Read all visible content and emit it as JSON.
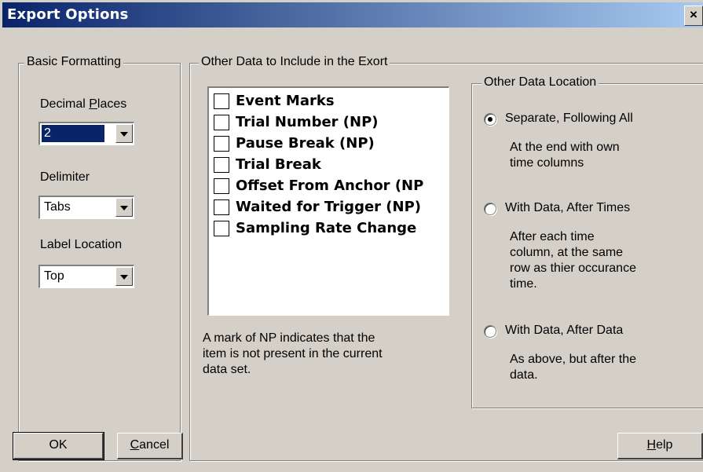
{
  "window": {
    "title": "Export Options",
    "close_glyph": "×"
  },
  "basic_formatting": {
    "legend": "Basic Formatting",
    "decimal_places": {
      "label_pre": "Decimal ",
      "label_acc": "P",
      "label_post": "laces",
      "value": "2"
    },
    "delimiter": {
      "label": "Delimiter",
      "value": "Tabs"
    },
    "label_location": {
      "label": "Label Location",
      "value": "Top"
    }
  },
  "other_data": {
    "legend": "Other Data to Include in the Exort",
    "items": [
      {
        "label": "Event Marks",
        "checked": false
      },
      {
        "label": "Trial Number (NP)",
        "checked": false
      },
      {
        "label": "Pause Break (NP)",
        "checked": false
      },
      {
        "label": "Trial Break",
        "checked": false
      },
      {
        "label": "Offset From Anchor (NP",
        "checked": false
      },
      {
        "label": "Waited for Trigger (NP)",
        "checked": false
      },
      {
        "label": "Sampling Rate Change",
        "checked": false
      }
    ],
    "note_lines": [
      "A mark of NP indicates that the",
      "item is not present in the current",
      "data set."
    ]
  },
  "location": {
    "legend": "Other Data Location",
    "options": [
      {
        "label": "Separate, Following All",
        "selected": true,
        "desc": [
          "At the end with own",
          "time columns"
        ]
      },
      {
        "label": "With Data, After Times",
        "selected": false,
        "desc": [
          "After each time",
          "column, at the same",
          "row as thier occurance",
          "time."
        ]
      },
      {
        "label": "With Data, After Data",
        "selected": false,
        "desc": [
          "As above, but after the",
          "data."
        ]
      }
    ]
  },
  "buttons": {
    "ok": "OK",
    "cancel_acc": "C",
    "cancel_rest": "ancel",
    "help_acc": "H",
    "help_rest": "elp"
  },
  "icons": {
    "close": "close-icon",
    "dropdown": "chevron-down-icon",
    "radio": "radio-icon",
    "checkbox": "checkbox-icon"
  }
}
